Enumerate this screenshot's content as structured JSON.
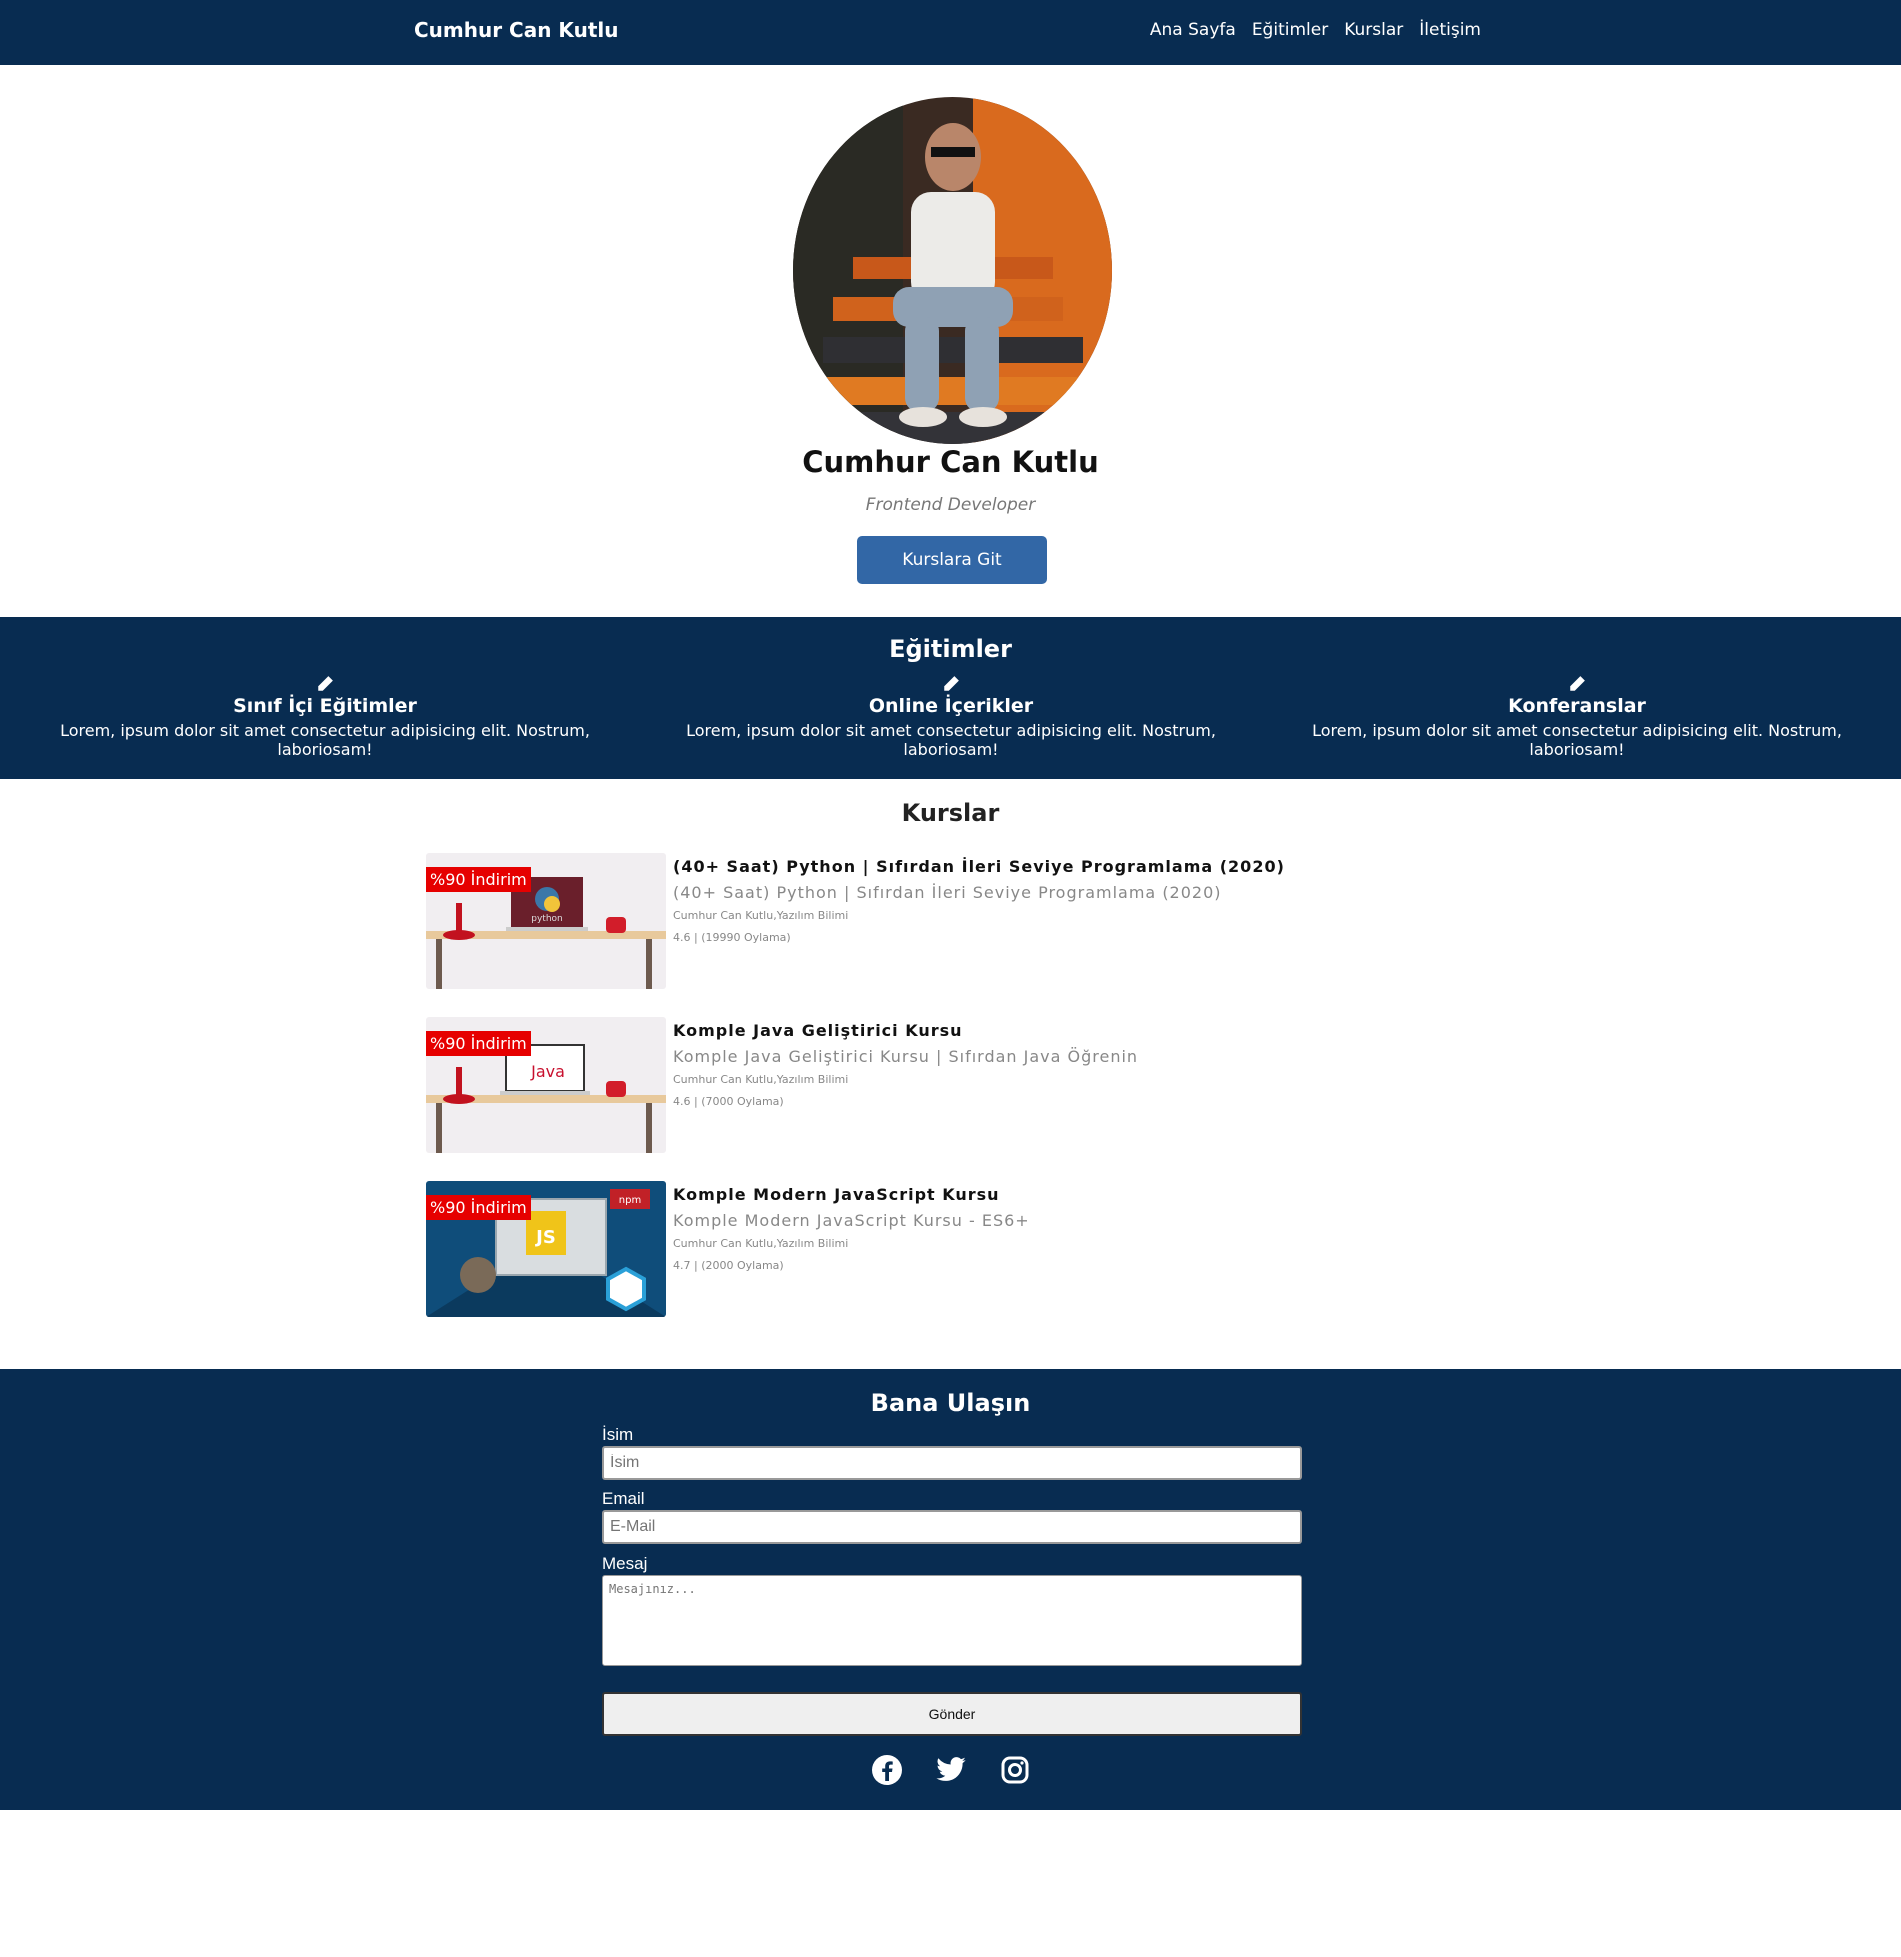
{
  "nav": {
    "brand": "Cumhur Can Kutlu",
    "links": [
      "Ana Sayfa",
      "Eğitimler",
      "Kurslar",
      "İletişim"
    ]
  },
  "hero": {
    "name": "Cumhur Can Kutlu",
    "role": "Frontend Developer",
    "button": "Kurslara Git"
  },
  "education": {
    "title": "Eğitimler",
    "items": [
      {
        "title": "Sınıf İçi Eğitimler",
        "text": "Lorem, ipsum dolor sit amet consectetur adipisicing elit. Nostrum, laboriosam!",
        "icon": "pencil-icon"
      },
      {
        "title": "Online İçerikler",
        "text": "Lorem, ipsum dolor sit amet consectetur adipisicing elit. Nostrum, laboriosam!",
        "icon": "pencil-icon"
      },
      {
        "title": "Konferanslar",
        "text": "Lorem, ipsum dolor sit amet consectetur adipisicing elit. Nostrum, laboriosam!",
        "icon": "pencil-icon"
      }
    ]
  },
  "courses": {
    "title": "Kurslar",
    "items": [
      {
        "badge": "%90 İndirim",
        "title": "(40+ Saat) Python | Sıfırdan İleri Seviye Programlama (2020)",
        "subtitle": "(40+ Saat) Python | Sıfırdan İleri Seviye Programlama (2020)",
        "author": "Cumhur Can Kutlu,Yazılım Bilimi",
        "rating": "4.6 | (19990 Oylama)",
        "thumb_label": "python"
      },
      {
        "badge": "%90 İndirim",
        "title": "Komple Java Geliştirici Kursu",
        "subtitle": "Komple Java Geliştirici Kursu | Sıfırdan Java Öğrenin",
        "author": "Cumhur Can Kutlu,Yazılım Bilimi",
        "rating": "4.6 | (7000 Oylama)",
        "thumb_label": "Java"
      },
      {
        "badge": "%90 İndirim",
        "title": "Komple Modern JavaScript Kursu",
        "subtitle": "Komple Modern JavaScript Kursu - ES6+",
        "author": "Cumhur Can Kutlu,Yazılım Bilimi",
        "rating": "4.7 | (2000 Oylama)",
        "thumb_label": "JS",
        "thumb_tag": "npm"
      }
    ]
  },
  "contact": {
    "title": "Bana Ulaşın",
    "name_label": "İsim",
    "name_placeholder": "İsim",
    "email_label": "Email",
    "email_placeholder": "E-Mail",
    "message_label": "Mesaj",
    "message_placeholder": "Mesajınız...",
    "send": "Gönder",
    "socials": [
      "facebook-icon",
      "twitter-icon",
      "instagram-icon"
    ]
  },
  "colors": {
    "navy": "#082c51",
    "button": "#3267a6",
    "badge": "#e60000"
  }
}
